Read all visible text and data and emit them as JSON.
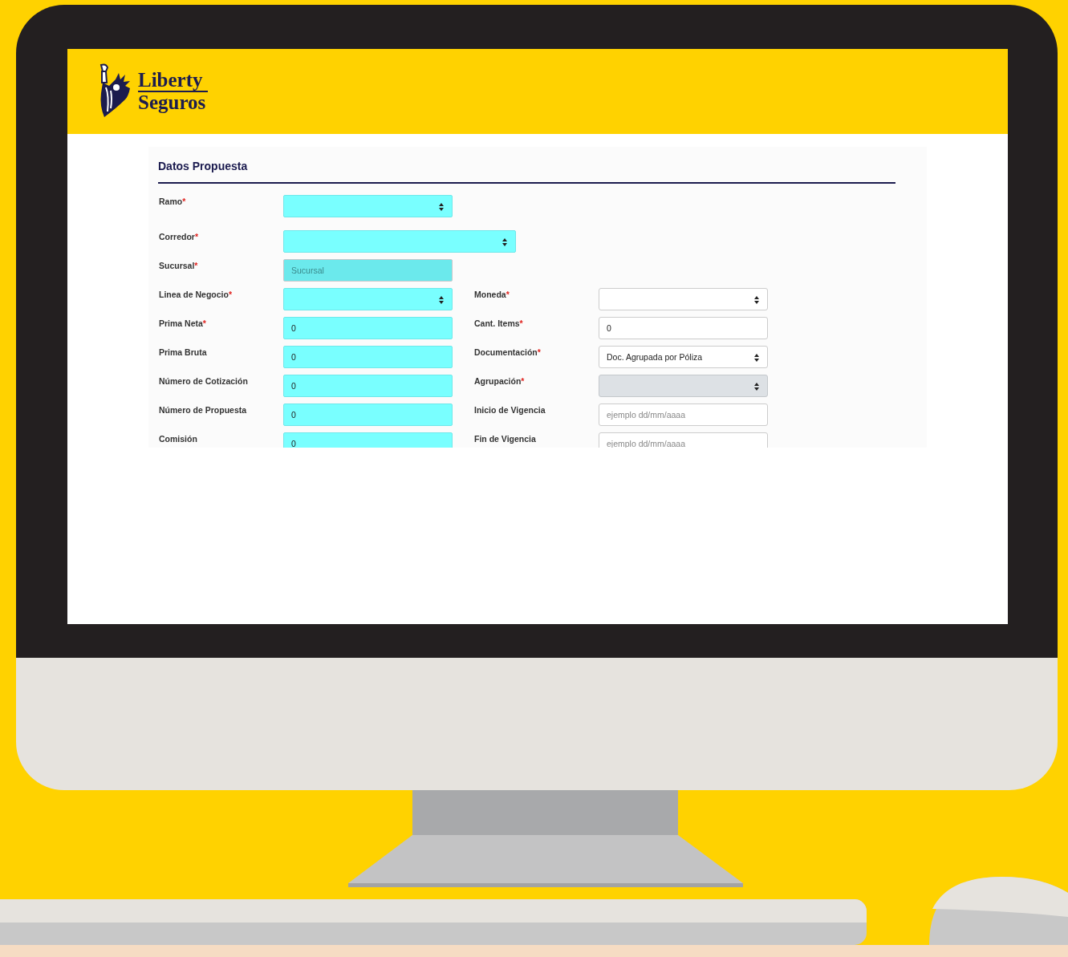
{
  "header": {
    "logo": {
      "line_1": "Liberty",
      "line_2": "Seguros"
    }
  },
  "form": {
    "title": "Datos Propuesta",
    "rows": [
      {
        "left": {
          "label": "Ramo",
          "mark": "*",
          "kind": "select",
          "highlighted": true,
          "disabled": false
        }
      },
      {
        "left": {
          "label": "Corredor",
          "mark": "*",
          "kind": "select",
          "highlighted": true,
          "disabled": false
        }
      },
      {
        "left": {
          "label": "Sucursal",
          "mark": "*",
          "kind": "input",
          "placeholder": "Sucursal",
          "highlighted": true,
          "disabled": true
        }
      },
      {
        "left": {
          "label": "Linea de Negocio",
          "mark": "*",
          "kind": "select",
          "highlighted": true,
          "disabled": false
        },
        "right": {
          "label": "Moneda",
          "mark": "*",
          "kind": "select",
          "highlighted": false,
          "disabled": false
        }
      },
      {
        "left": {
          "label": "Prima Neta",
          "mark": "*",
          "kind": "input",
          "value": "0",
          "highlighted": true,
          "disabled": false
        },
        "right": {
          "label": "Cant. Items",
          "mark": "*",
          "kind": "input",
          "value": "0",
          "highlighted": false,
          "disabled": false
        }
      },
      {
        "left": {
          "label": "Prima Bruta",
          "kind": "input",
          "value": "0",
          "highlighted": true,
          "disabled": false
        },
        "right": {
          "label": "Documentación",
          "mark": "*",
          "kind": "select",
          "value": "Doc. Agrupada por Póliza",
          "highlighted": false,
          "disabled": false
        }
      },
      {
        "left": {
          "label": "Número de Cotización",
          "kind": "input",
          "value": "0",
          "highlighted": true,
          "disabled": false
        },
        "right": {
          "label": "Agrupación",
          "mark": "*",
          "kind": "select",
          "highlighted": false,
          "disabled": true
        }
      },
      {
        "left": {
          "label": "Número de Propuesta",
          "kind": "input",
          "value": "0",
          "highlighted": true,
          "disabled": false
        },
        "right": {
          "label": "Inicio de Vigencia",
          "kind": "input",
          "placeholder": "ejemplo dd/mm/aaaa",
          "highlighted": false,
          "disabled": false
        }
      },
      {
        "left": {
          "label": "Comisión",
          "kind": "input",
          "value": "0",
          "highlighted": true,
          "disabled": false
        },
        "right": {
          "label": "Fin de Vigencia",
          "kind": "input",
          "placeholder": "ejemplo dd/mm/aaaa",
          "highlighted": false,
          "disabled": false
        }
      }
    ]
  }
}
